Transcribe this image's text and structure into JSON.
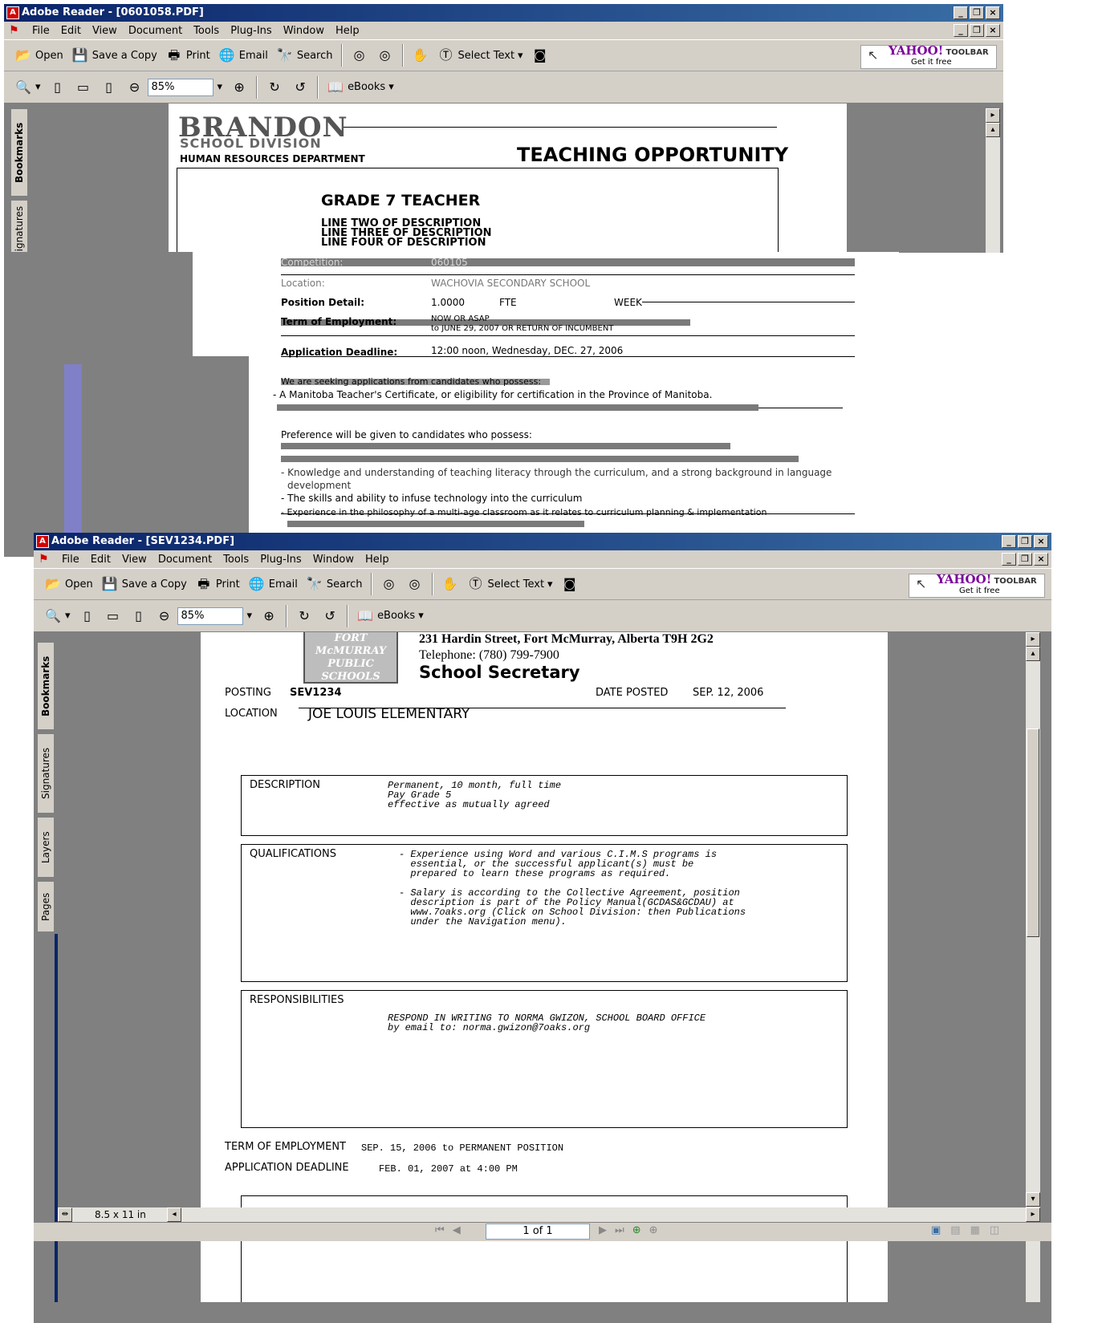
{
  "window1": {
    "title": "Adobe Reader - [0601058.PDF]",
    "menu": [
      "File",
      "Edit",
      "View",
      "Document",
      "Tools",
      "Plug-Ins",
      "Window",
      "Help"
    ],
    "toolbar": {
      "open": "Open",
      "save_copy": "Save a Copy",
      "print": "Print",
      "email": "Email",
      "search": "Search",
      "select_text": "Select Text",
      "zoom": "85%",
      "ebooks": "eBooks"
    },
    "yahoo": {
      "brand": "YAHOO!",
      "label": "TOOLBAR",
      "sub": "Get it free"
    },
    "sidetabs": [
      "Bookmarks",
      "Signatures"
    ],
    "document": {
      "org_name": "BRANDON",
      "org_sub": "SCHOOL DIVISION",
      "department": "HUMAN RESOURCES DEPARTMENT",
      "heading": "TEACHING OPPORTUNITY",
      "job_title": "GRADE 7 TEACHER",
      "line2": "LINE TWO OF DESCRIPTION",
      "line3": "LINE THREE OF DESCRIPTION",
      "line4": "LINE FOUR OF DESCRIPTION",
      "competition_label": "Competition:",
      "competition_value": "060105",
      "location_label": "Location:",
      "location_value": "WACHOVIA SECONDARY SCHOOL",
      "position_label": "Position Detail:",
      "position_value": "1.0000",
      "position_fte": "FTE",
      "position_week": "WEEK",
      "term_label": "Term of Employment:",
      "term_value_1": "NOW OR ASAP",
      "term_value_2": "to JUNE 29, 2007 OR RETURN OF INCUMBENT",
      "deadline_label": "Application Deadline:",
      "deadline_value": "12:00 noon, Wednesday, DEC. 27, 2006",
      "seeking": "We are seeking applications from candidates who possess:",
      "req1": "- A Manitoba Teacher's Certificate, or eligibility for certification in the Province of Manitoba.",
      "preference": "Preference will be given to candidates who possess:",
      "pref3": "- Knowledge and understanding of teaching literacy through the curriculum, and a strong background in language",
      "pref3b": "development",
      "pref4": "- The skills and ability to infuse technology into the curriculum",
      "pref5": "- Experience in the philosophy of a multi-age classroom as it relates to curriculum planning & implementation"
    }
  },
  "window2": {
    "title": "Adobe Reader - [SEV1234.PDF]",
    "menu": [
      "File",
      "Edit",
      "View",
      "Document",
      "Tools",
      "Plug-Ins",
      "Window",
      "Help"
    ],
    "toolbar": {
      "open": "Open",
      "save_copy": "Save a Copy",
      "print": "Print",
      "email": "Email",
      "search": "Search",
      "select_text": "Select Text",
      "zoom": "85%",
      "ebooks": "eBooks"
    },
    "yahoo": {
      "brand": "YAHOO!",
      "label": "TOOLBAR",
      "sub": "Get it free"
    },
    "sidetabs": [
      "Bookmarks",
      "Signatures",
      "Layers",
      "Pages"
    ],
    "document": {
      "logo_text": "FORT McMURRAY PUBLIC SCHOOLS",
      "address": "231 Hardin Street, Fort McMurray, Alberta  T9H 2G2",
      "telephone": "Telephone:  (780) 799-7900",
      "title": "School Secretary",
      "posting_label": "POSTING",
      "posting_value": "SEV1234",
      "date_posted_label": "DATE POSTED",
      "date_posted_value": "SEP. 12, 2006",
      "location_label": "LOCATION",
      "location_value": "JOE LOUIS ELEMENTARY",
      "description_label": "DESCRIPTION",
      "description_text": "Permanent, 10 month, full time\nPay Grade 5\neffective as mutually agreed",
      "qualifications_label": "QUALIFICATIONS",
      "qualifications_text": "- Experience using Word and various C.I.M.S programs is\n  essential, or the successful applicant(s) must be\n  prepared to learn these programs as required.\n\n- Salary is according to the Collective Agreement, position\n  description is part of the Policy Manual(GCDAS&GCDAU) at\n  www.7oaks.org (Click on School Division: then Publications\n  under the Navigation menu).",
      "responsibilities_label": "RESPONSIBILITIES",
      "responsibilities_text": "RESPOND IN WRITING TO NORMA GWIZON, SCHOOL BOARD OFFICE\nby email to: norma.gwizon@7oaks.org",
      "term_label": "TERM OF EMPLOYMENT",
      "term_value": "SEP. 15, 2006 to PERMANENT POSITION",
      "deadline_label": "APPLICATION DEADLINE",
      "deadline_value": "FEB. 01, 2007 at  4:00 PM"
    },
    "status": {
      "page_size": "8.5 x 11 in",
      "page_indicator": "1 of 1"
    }
  }
}
